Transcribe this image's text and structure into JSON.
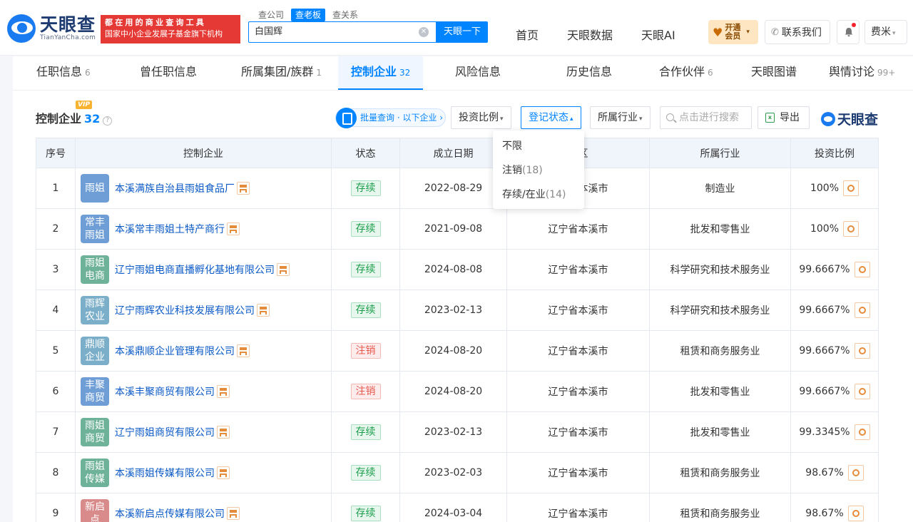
{
  "brand": {
    "name_cn": "天眼查",
    "name_en": "TianYanCha.com",
    "slogan_line1": "都在用的商业查询工具",
    "slogan_line2": "国家中小企业发展子基金旗下机构",
    "watermark": "天眼查"
  },
  "search": {
    "tabs": [
      "查公司",
      "查老板",
      "查关系"
    ],
    "active_tab": "查老板",
    "query": "白国辉",
    "button": "天眼一下"
  },
  "nav": {
    "home": "首页",
    "data": "天眼数据",
    "ai": "天眼AI",
    "vip": "开通会员",
    "contact": "联系我们",
    "user": "费米"
  },
  "subtabs": [
    {
      "label": "任职信息",
      "count": "6"
    },
    {
      "label": "曾任职信息",
      "count": ""
    },
    {
      "label": "所属集团/族群",
      "count": "1"
    },
    {
      "label": "控制企业",
      "count": "32"
    },
    {
      "label": "风险信息",
      "count": ""
    },
    {
      "label": "历史信息",
      "count": ""
    },
    {
      "label": "合作伙伴",
      "count": "6"
    },
    {
      "label": "天眼图谱",
      "count": ""
    },
    {
      "label": "舆情讨论",
      "count": "99+"
    }
  ],
  "section": {
    "title": "控制企业",
    "count": "32",
    "vip": "VIP",
    "help": "?"
  },
  "toolbar": {
    "batch": "批量查询 · 以下企业",
    "ratio": "投资比例",
    "status": "登记状态",
    "industry": "所属行业",
    "search_placeholder": "点击进行搜索",
    "export": "导出"
  },
  "dropdown": [
    {
      "label": "不限",
      "count": ""
    },
    {
      "label": "注销",
      "count": "(18)"
    },
    {
      "label": "存续/在业",
      "count": "(14)"
    }
  ],
  "table": {
    "headers": [
      "序号",
      "控制企业",
      "状态",
      "成立日期",
      "地区",
      "所属行业",
      "投资比例"
    ],
    "rows": [
      {
        "idx": "1",
        "avatar": "雨姐",
        "avatar_color": "#6f9ed6",
        "name": "本溪满族自治县雨姐食品厂",
        "status": "存续",
        "status_type": "ok",
        "date": "2022-08-29",
        "region": "辽宁省本溪市",
        "industry": "制造业",
        "ratio": "100%"
      },
      {
        "idx": "2",
        "avatar": "常丰雨姐",
        "avatar_color": "#6f9ed6",
        "name": "本溪常丰雨姐土特产商行",
        "status": "存续",
        "status_type": "ok",
        "date": "2021-09-08",
        "region": "辽宁省本溪市",
        "industry": "批发和零售业",
        "ratio": "100%"
      },
      {
        "idx": "3",
        "avatar": "雨姐电商",
        "avatar_color": "#6fb29a",
        "name": "辽宁雨姐电商直播孵化基地有限公司",
        "status": "存续",
        "status_type": "ok",
        "date": "2024-08-08",
        "region": "辽宁省本溪市",
        "industry": "科学研究和技术服务业",
        "ratio": "99.6667%"
      },
      {
        "idx": "4",
        "avatar": "雨辉农业",
        "avatar_color": "#7aaec9",
        "name": "辽宁雨辉农业科技发展有限公司",
        "status": "存续",
        "status_type": "ok",
        "date": "2023-02-13",
        "region": "辽宁省本溪市",
        "industry": "科学研究和技术服务业",
        "ratio": "99.6667%"
      },
      {
        "idx": "5",
        "avatar": "鼎顺企业",
        "avatar_color": "#7aaec9",
        "name": "本溪鼎顺企业管理有限公司",
        "status": "注销",
        "status_type": "bad",
        "date": "2024-08-20",
        "region": "辽宁省本溪市",
        "industry": "租赁和商务服务业",
        "ratio": "99.6667%"
      },
      {
        "idx": "6",
        "avatar": "丰聚商贸",
        "avatar_color": "#6f9ed6",
        "name": "本溪丰聚商贸有限公司",
        "status": "注销",
        "status_type": "bad",
        "date": "2024-08-20",
        "region": "辽宁省本溪市",
        "industry": "批发和零售业",
        "ratio": "99.6667%"
      },
      {
        "idx": "7",
        "avatar": "雨姐商贸",
        "avatar_color": "#6fb29a",
        "name": "辽宁雨姐商贸有限公司",
        "status": "存续",
        "status_type": "ok",
        "date": "2023-02-13",
        "region": "辽宁省本溪市",
        "industry": "批发和零售业",
        "ratio": "99.3345%"
      },
      {
        "idx": "8",
        "avatar": "雨姐传媒",
        "avatar_color": "#6fb29a",
        "name": "本溪雨姐传媒有限公司",
        "status": "存续",
        "status_type": "ok",
        "date": "2023-02-03",
        "region": "辽宁省本溪市",
        "industry": "租赁和商务服务业",
        "ratio": "98.67%"
      },
      {
        "idx": "9",
        "avatar": "新启点",
        "avatar_color": "#d98a8a",
        "name": "本溪新启点传媒有限公司",
        "status": "存续",
        "status_type": "ok",
        "date": "2024-03-04",
        "region": "辽宁省本溪市",
        "industry": "租赁和商务服务业",
        "ratio": "98.67%"
      }
    ]
  }
}
